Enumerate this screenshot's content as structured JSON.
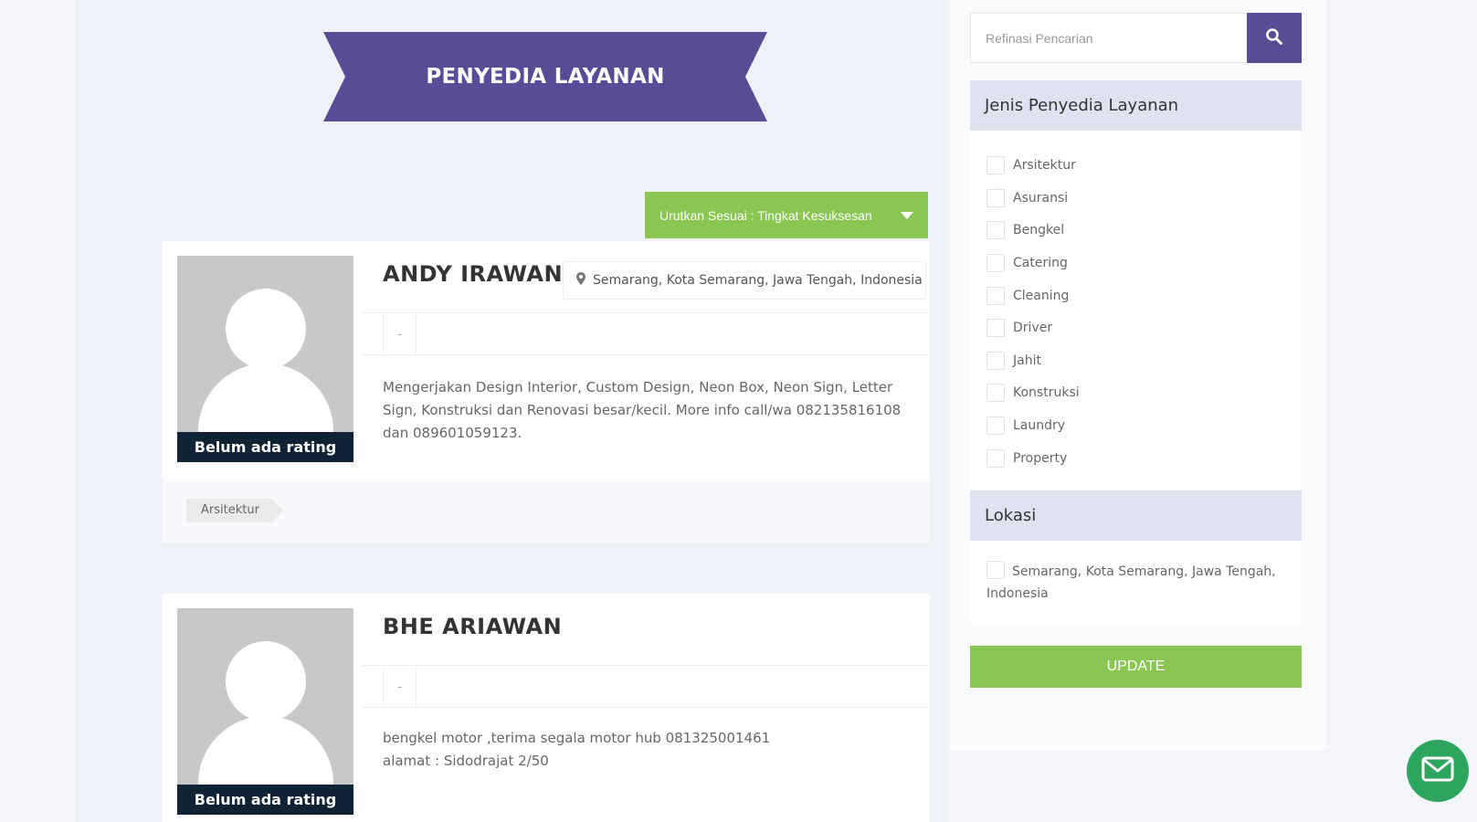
{
  "header": {
    "title": "PENYEDIA LAYANAN"
  },
  "sort": {
    "label": "Urutkan Sesuai : Tingkat Kesuksesan"
  },
  "providers": [
    {
      "name": "ANDY IRAWAN",
      "location": "Semarang, Kota Semarang, Jawa Tengah, Indonesia",
      "rating_text": "Belum ada rating",
      "meta": "-",
      "description": "Mengerjakan Design Interior, Custom Design, Neon Box, Neon Sign, Letter Sign, Konstruksi dan Renovasi besar/kecil. More info call/wa 082135816108 dan 089601059123.",
      "tag": "Arsitektur"
    },
    {
      "name": "BHE ARIAWAN",
      "rating_text": "Belum ada rating",
      "meta": "-",
      "description_lines": [
        "bengkel motor ,terima segala motor hub 081325001461",
        "alamat : Sidodrajat 2/50"
      ]
    }
  ],
  "sidebar": {
    "search_placeholder": "Refinasi Pencarian",
    "types_title": "Jenis Penyedia Layanan",
    "types": [
      "Arsitektur",
      "Asuransi",
      "Bengkel",
      "Catering",
      "Cleaning",
      "Driver",
      "Jahit",
      "Konstruksi",
      "Laundry",
      "Property"
    ],
    "location_title": "Lokasi",
    "location_option": "Semarang, Kota Semarang, Jawa Tengah, Indonesia",
    "update_label": "UPDATE"
  },
  "icons": {
    "search": "search-icon",
    "pin": "map-pin-icon",
    "mail": "mail-icon",
    "caret": "caret-down-icon"
  },
  "colors": {
    "purple": "#5a4b96",
    "green": "#8ac652",
    "navy": "#102334",
    "mail_green": "#2da55e"
  }
}
